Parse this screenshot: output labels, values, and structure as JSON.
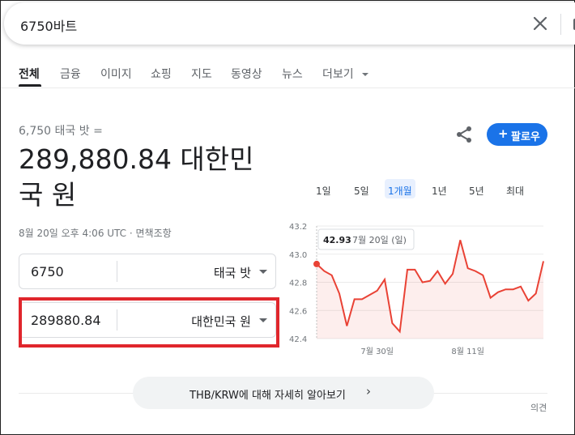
{
  "search": {
    "query": "6750바트"
  },
  "tabs": [
    {
      "label": "전체"
    },
    {
      "label": "금융"
    },
    {
      "label": "이미지"
    },
    {
      "label": "쇼핑"
    },
    {
      "label": "지도"
    },
    {
      "label": "동영상"
    },
    {
      "label": "뉴스"
    },
    {
      "label": "더보기"
    }
  ],
  "converter": {
    "from_label": "6,750 태국 밧 =",
    "result": "289,880.84 대한민국 원",
    "meta": "8월 20일 오후 4:06 UTC · 면책조항",
    "from_value": "6750",
    "from_unit": "태국 밧",
    "to_value": "289880.84",
    "to_unit": "대한민국 원"
  },
  "actions": {
    "follow_plus": "+",
    "follow_label": "팔로우"
  },
  "ranges": [
    "1일",
    "5일",
    "1개월",
    "1년",
    "5년",
    "최대"
  ],
  "active_range": "1개월",
  "chart_data": {
    "type": "line",
    "tooltip_value": "42.93",
    "tooltip_date": "7월 20일 (일)",
    "y_ticks": [
      "43.2",
      "43.0",
      "42.8",
      "42.6",
      "42.4"
    ],
    "ylim": [
      42.4,
      43.2
    ],
    "x_ticks": [
      {
        "label": "7월 30일",
        "index": 8
      },
      {
        "label": "8월 11일",
        "index": 20
      }
    ],
    "values": [
      42.93,
      42.88,
      42.85,
      42.72,
      42.49,
      42.68,
      42.68,
      42.71,
      42.74,
      42.82,
      42.51,
      42.45,
      42.89,
      42.89,
      42.8,
      42.81,
      42.88,
      42.79,
      42.86,
      43.1,
      42.9,
      42.88,
      42.85,
      42.69,
      42.73,
      42.75,
      42.75,
      42.77,
      42.67,
      42.72,
      42.95
    ],
    "color": "#e94235"
  },
  "footer": {
    "learn_more": "THB/KRW에 대해 자세히 알아보기",
    "feedback": "의견"
  }
}
